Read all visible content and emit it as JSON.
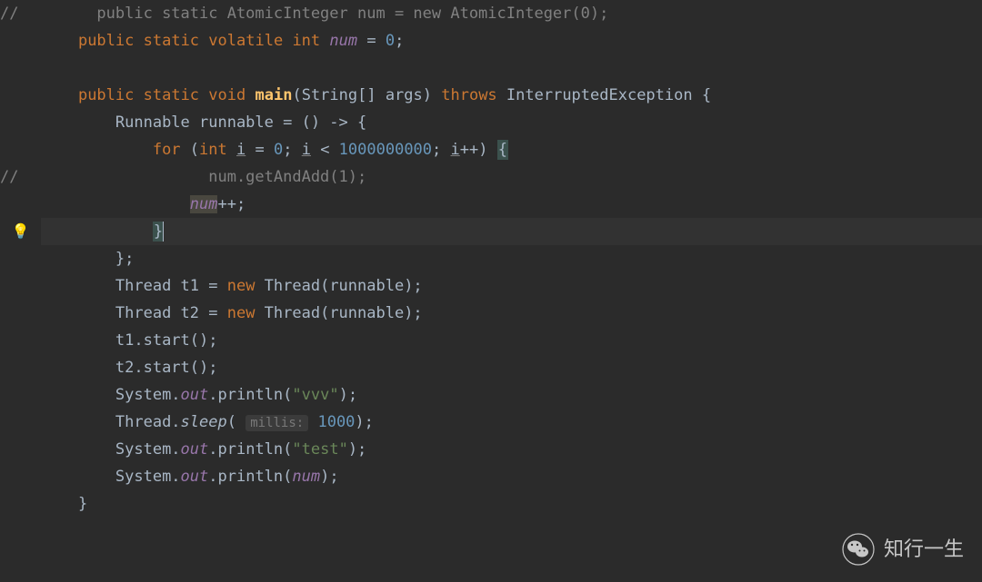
{
  "code": {
    "l1_comment_marker": "//",
    "l1_comment_body": "    public static AtomicInteger num = new AtomicInteger(0);",
    "l2_public": "public",
    "l2_static": "static",
    "l2_volatile": "volatile",
    "l2_int": "int",
    "l2_num": "num",
    "l2_eq": " = ",
    "l2_zero": "0",
    "l2_semi": ";",
    "l4_public": "public",
    "l4_static": "static",
    "l4_void": "void",
    "l4_main": "main",
    "l4_lparen": "(",
    "l4_string": "String[] args",
    "l4_rparen": ") ",
    "l4_throws": "throws",
    "l4_exc": " InterruptedException {",
    "l5_runnable_decl": "Runnable runnable = () -> {",
    "l6_for": "for",
    "l6_open": " (",
    "l6_int": "int",
    "l6_init": " ",
    "l6_i1": "i",
    "l6_eq": " = ",
    "l6_zero": "0",
    "l6_semi1": "; ",
    "l6_i2": "i",
    "l6_lt": " < ",
    "l6_billion": "1000000000",
    "l6_semi2": "; ",
    "l6_i3": "i",
    "l6_pp": "++) ",
    "l6_brace": "{",
    "l7_comment_marker": "//",
    "l7_comment_body": "                num.getAndAdd(1);",
    "l8_num": "num",
    "l8_pp": "++;",
    "l9_brace": "}",
    "l10_close": "};",
    "l11_decl": "Thread t1 = ",
    "l11_new": "new",
    "l11_call": " Thread(runnable);",
    "l12_decl": "Thread t2 = ",
    "l12_new": "new",
    "l12_call": " Thread(runnable);",
    "l13": "t1.start();",
    "l14": "t2.start();",
    "l15_sys": "System.",
    "l15_out": "out",
    "l15_print": ".println(",
    "l15_str": "\"vvv\"",
    "l15_end": ");",
    "l16_thread": "Thread.",
    "l16_sleep": "sleep",
    "l16_open": "( ",
    "l16_hint": "millis:",
    "l16_val": " 1000",
    "l16_end": ");",
    "l17_sys": "System.",
    "l17_out": "out",
    "l17_print": ".println(",
    "l17_str": "\"test\"",
    "l17_end": ");",
    "l18_sys": "System.",
    "l18_out": "out",
    "l18_print": ".println(",
    "l18_num": "num",
    "l18_end": ");",
    "l19_brace": "}"
  },
  "watermark": {
    "text": "知行一生"
  }
}
